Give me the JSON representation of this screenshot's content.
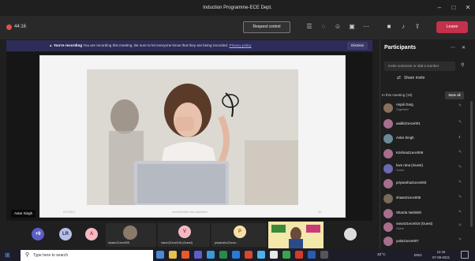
{
  "window": {
    "title": "Induction Programme-ECE Dept."
  },
  "meeting": {
    "timer": "44:16",
    "request_control": "Request control",
    "leave": "Leave"
  },
  "banner": {
    "bold": "You're recording",
    "text": "You are recording this meeting. Be sure to let everyone know that they are being recorded.",
    "link": "Privacy policy",
    "dismiss": "Dismiss"
  },
  "slide": {
    "date": "9/7/2021",
    "confidential": "confidential and classified",
    "page": "22"
  },
  "presenter": {
    "name": "Avtar Singh"
  },
  "strip": {
    "circles": [
      {
        "label": "+9",
        "color": "#5b5fc7"
      },
      {
        "label": "LR",
        "color": "#b4c0e8"
      },
      {
        "label": "A",
        "color": "#f4b9c3"
      }
    ],
    "tiles": [
      {
        "label": "shaan21ece005"
      },
      {
        "label": "varun21ece016 (Guest)"
      },
      {
        "label": "priyanshu21ece..."
      }
    ],
    "tile_initials": [
      "V",
      "P"
    ]
  },
  "panel": {
    "title": "Participants",
    "invite_placeholder": "Invite someone or dial a number",
    "share_invite": "Share invite",
    "in_meeting": "In this meeting (19)",
    "mute_all": "Mute all",
    "participants": [
      {
        "name": "Anjali Garg",
        "role": "Organiser"
      },
      {
        "name": "aadiki21ece001",
        "role": ""
      },
      {
        "name": "Avtar Singh",
        "role": ""
      },
      {
        "name": "Krishna21ece009",
        "role": ""
      },
      {
        "name": "love rana (Guest)",
        "role": "Guest"
      },
      {
        "name": "priyanshu21ece003",
        "role": ""
      },
      {
        "name": "shaan21ece005",
        "role": ""
      },
      {
        "name": "Sharda Vashisth",
        "role": ""
      },
      {
        "name": "varun21ece016 (Guest)",
        "role": "Guest"
      },
      {
        "name": "yatin21ece007",
        "role": ""
      }
    ]
  },
  "taskbar": {
    "search": "Type here to search",
    "weather": "32°C",
    "lang": "ENG",
    "time": "12:44",
    "date": "07-09-2021"
  }
}
